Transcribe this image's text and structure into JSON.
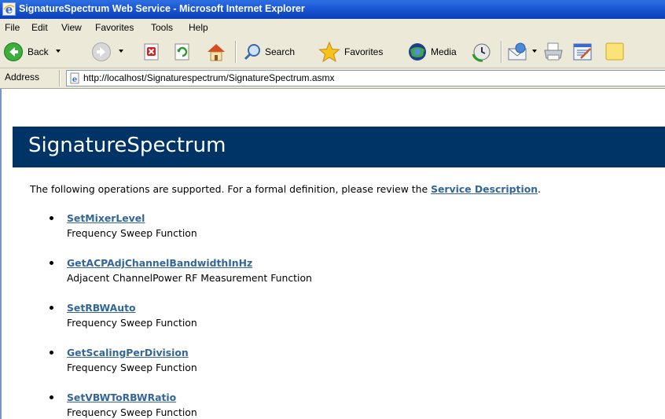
{
  "window": {
    "title": "SignatureSpectrum Web Service - Microsoft Internet Explorer",
    "title_bar_color": "#1a57d6"
  },
  "menu": {
    "items": [
      "File",
      "Edit",
      "View",
      "Favorites",
      "Tools",
      "Help"
    ]
  },
  "toolbar": {
    "back_label": "Back",
    "search_label": "Search",
    "favorites_label": "Favorites",
    "media_label": "Media",
    "icons": [
      "back-icon",
      "forward-icon",
      "stop-icon",
      "refresh-icon",
      "home-icon",
      "search-icon",
      "favorites-icon",
      "media-icon",
      "history-icon",
      "mail-icon",
      "print-icon",
      "edit-icon",
      "discuss-icon"
    ]
  },
  "address": {
    "label": "Address",
    "url": "http://localhost/Signaturespectrum/SignatureSpectrum.asmx"
  },
  "page": {
    "heading": "SignatureSpectrum",
    "banner_color": "#003366",
    "link_color": "#336699",
    "intro_text": "The following operations are supported. For a formal definition, please review the ",
    "intro_link": "Service Description",
    "intro_end": ".",
    "operations": [
      {
        "name": "SetMixerLevel",
        "description": "Frequency Sweep Function"
      },
      {
        "name": "GetACPAdjChannelBandwidthInHz",
        "description": "Adjacent ChannelPower RF Measurement Function"
      },
      {
        "name": "SetRBWAuto",
        "description": "Frequency Sweep Function"
      },
      {
        "name": "GetScalingPerDivision",
        "description": "Frequency Sweep Function"
      },
      {
        "name": "SetVBWToRBWRatio",
        "description": "Frequency Sweep Function"
      }
    ]
  }
}
